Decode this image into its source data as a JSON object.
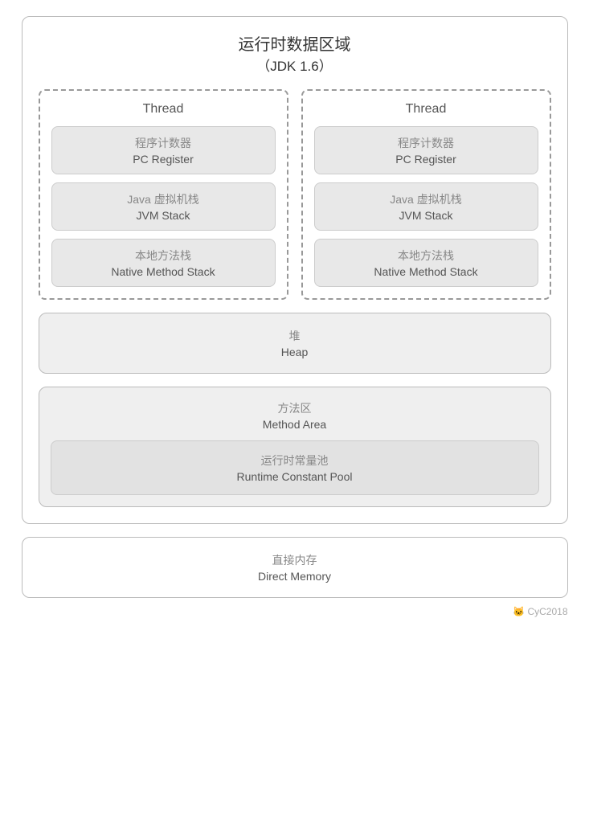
{
  "title": {
    "main": "运行时数据区域",
    "sub": "（JDK 1.6）"
  },
  "threads": [
    {
      "label": "Thread",
      "blocks": [
        {
          "chinese": "程序计数器",
          "english": "PC Register"
        },
        {
          "chinese": "Java 虚拟机栈",
          "english": "JVM Stack"
        },
        {
          "chinese": "本地方法栈",
          "english": "Native Method Stack"
        }
      ]
    },
    {
      "label": "Thread",
      "blocks": [
        {
          "chinese": "程序计数器",
          "english": "PC Register"
        },
        {
          "chinese": "Java 虚拟机栈",
          "english": "JVM Stack"
        },
        {
          "chinese": "本地方法栈",
          "english": "Native Method Stack"
        }
      ]
    }
  ],
  "heap": {
    "chinese": "堆",
    "english": "Heap"
  },
  "methodArea": {
    "chinese": "方法区",
    "english": "Method Area",
    "inner": {
      "chinese": "运行时常量池",
      "english": "Runtime Constant Pool"
    }
  },
  "directMemory": {
    "chinese": "直接内存",
    "english": "Direct Memory"
  },
  "watermark": "🐱 CyC2018"
}
